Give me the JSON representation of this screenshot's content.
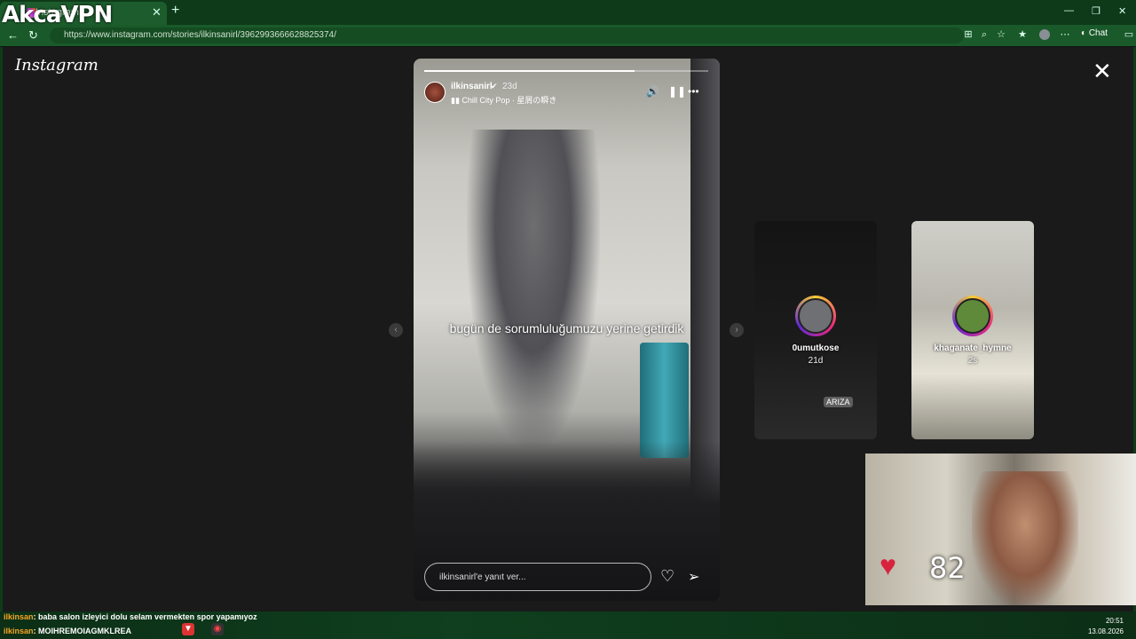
{
  "browser": {
    "tab_title": "Instagram",
    "url": "https://www.instagram.com/stories/ilkinsanirl/3962993666628825374/",
    "chat_label": "Chat",
    "watermark": "AkcaVPN"
  },
  "instagram": {
    "logo": "Instagram",
    "story": {
      "username": "ilkinsanirl",
      "time": "23d",
      "music": "Chill City Pop · 星屑の瞬き",
      "caption": "bugün de sorumluluğumuzu yerine getirdik",
      "reply_placeholder": "ilkinsanirl'e yanıt ver...",
      "progress": 0.74
    },
    "previews": [
      {
        "username": "0umutkose",
        "time": "21d",
        "tag": "ARIZA"
      },
      {
        "username": "khaganate_hymne",
        "time": "2s"
      }
    ]
  },
  "overlay": {
    "heart_rate": "82",
    "chat": [
      {
        "user": "ilkinsan",
        "message": ": baba salon izleyici dolu selam vermekten spor yapamıyoz"
      },
      {
        "user": "ilkinsan",
        "message": ": MOIHREMOIAGMKLREA"
      }
    ],
    "clock_time": "20:51",
    "clock_date": "13.08.2026"
  }
}
